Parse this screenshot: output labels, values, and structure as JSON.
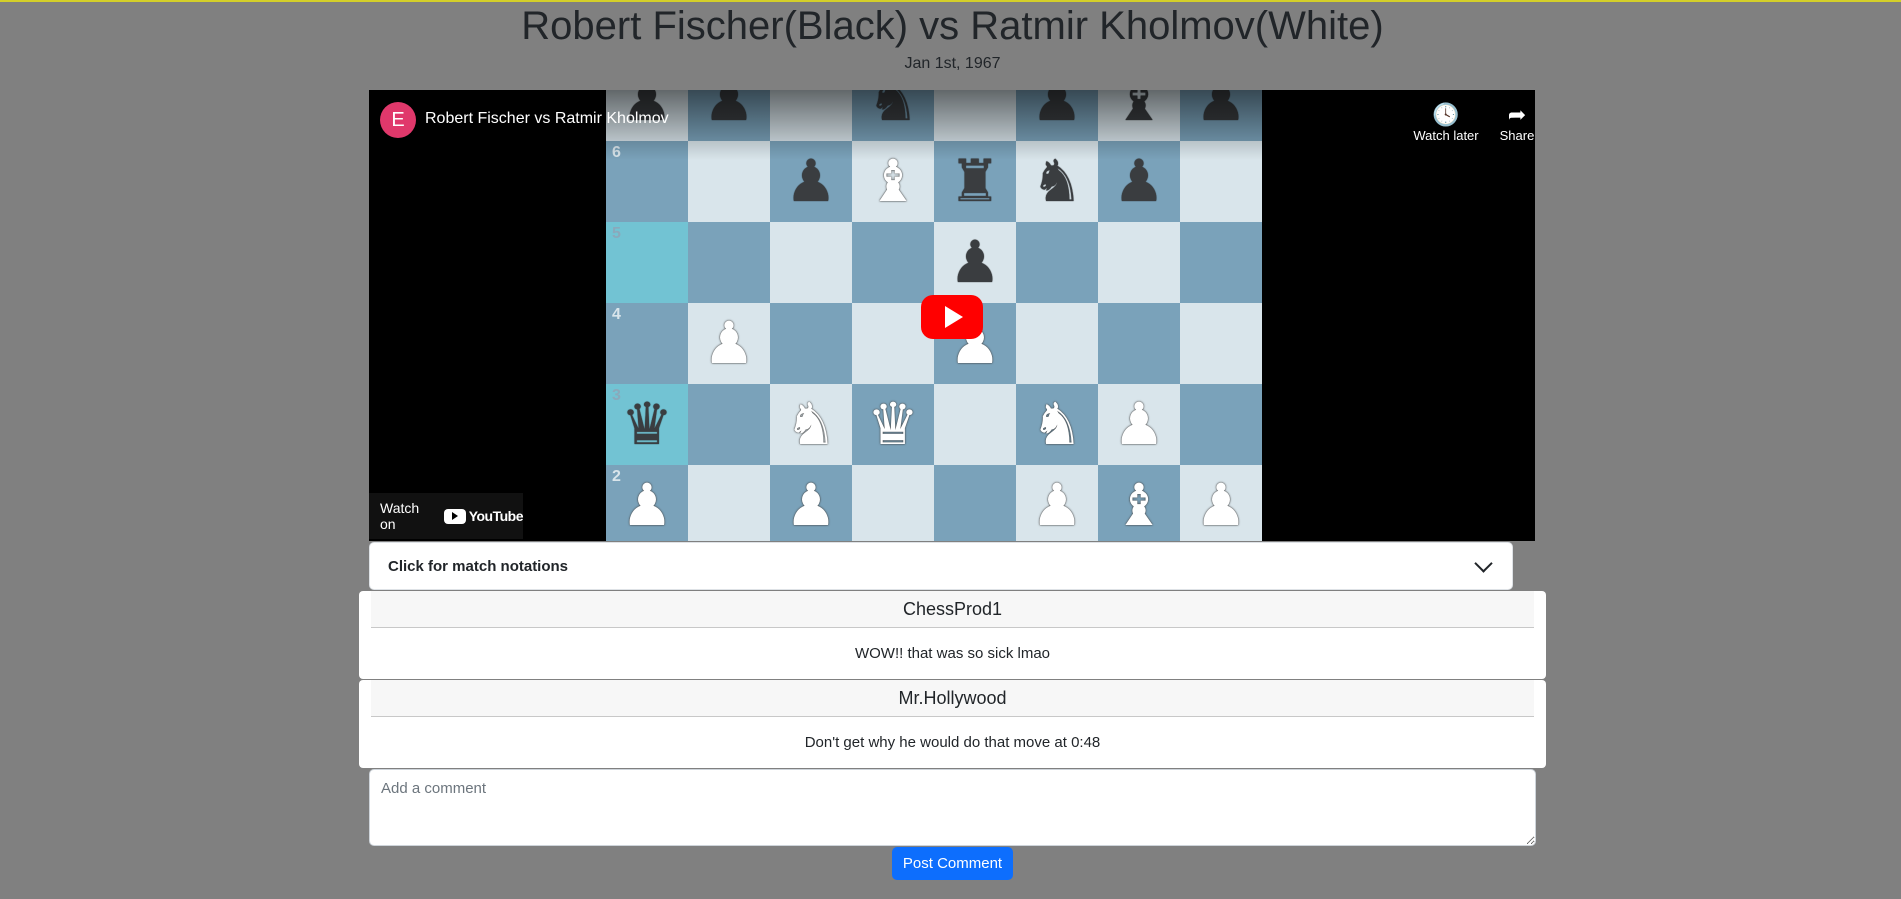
{
  "page": {
    "title": "Robert Fischer(Black) vs Ratmir Kholmov(White)",
    "date": "Jan 1st, 1967"
  },
  "video": {
    "channel_initial": "E",
    "title": "Robert Fischer vs Ratmir Kholmov",
    "watch_later_label": "Watch later",
    "share_label": "Share",
    "watch_on_label": "Watch on",
    "youtube_label": "YouTube",
    "board": {
      "rank_labels": [
        "",
        "6",
        "5",
        "4",
        "3",
        "2"
      ],
      "rows": [
        [
          "bp",
          "bp",
          "",
          "bn",
          "",
          "bp",
          "bb",
          "bp"
        ],
        [
          "",
          "",
          "bp",
          "wb",
          "br",
          "bn",
          "bp",
          ""
        ],
        [
          "",
          "",
          "",
          "",
          "bp",
          "",
          "",
          ""
        ],
        [
          "",
          "wp",
          "",
          "",
          "wp",
          "",
          "",
          ""
        ],
        [
          "bq",
          "",
          "wn",
          "wq",
          "",
          "wn",
          "wp",
          ""
        ],
        [
          "wp",
          "",
          "wp",
          "",
          "",
          "wp",
          "wb",
          "wp"
        ]
      ],
      "highlight": [
        [
          2,
          0
        ],
        [
          4,
          0
        ]
      ]
    }
  },
  "accordion": {
    "label": "Click for match notations"
  },
  "comments": [
    {
      "author": "ChessProd1",
      "text": "WOW!! that was so sick lmao"
    },
    {
      "author": "Mr.Hollywood",
      "text": "Don't get why he would do that move at 0:48"
    }
  ],
  "comment_form": {
    "placeholder": "Add a comment",
    "submit_label": "Post Comment"
  }
}
